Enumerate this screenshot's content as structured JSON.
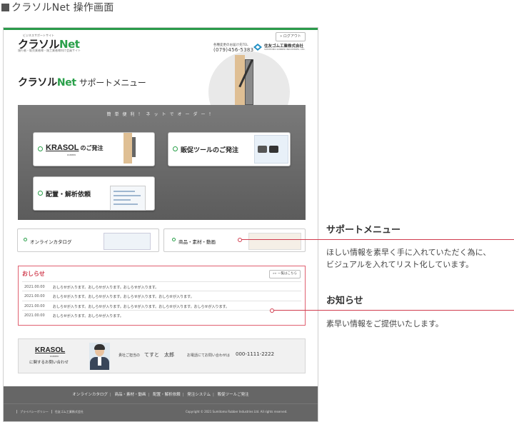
{
  "caption": "クラソルNet 操作画面",
  "header": {
    "logo_small": "ビジネスサポートサイト",
    "logo_main": "クラソル",
    "logo_net": "Net",
    "logo_sub": "施行者・販売業者様・施工業者様向け会員サイト",
    "logout": "» ログアウト",
    "tel_label": "各種変更のお届け先TEL",
    "tel": "(079)456-5383",
    "corp": "住友ゴム工業株式会社",
    "corp_en": "SUMITOMO RUBBER INDUSTRIES, LTD."
  },
  "page_title": {
    "brand": "クラソル",
    "net": "Net",
    "sub": "サポートメニュー"
  },
  "banner": {
    "title": "簡単便利！ネットでオーダー！",
    "krasol_logo": "KRASOL",
    "krasol_sub": "RUBBER",
    "krasol_suffix": "のご発注",
    "promo": "販促ツールのご発注",
    "layout": "配置・解析依頼"
  },
  "links": {
    "catalog": "オンラインカタログ",
    "products": "商品・素材・動画"
  },
  "news": {
    "title": "おしらせ",
    "list_button": "»» 一覧はこちら",
    "items": [
      {
        "date": "2021.00.00",
        "text": "おしらせが入ります。おしらせが入ります。おしらせが入ります。"
      },
      {
        "date": "2021.00.00",
        "text": "おしらせが入ります。おしらせが入ります。おしらせが入ります。おしらせが入ります。"
      },
      {
        "date": "2021.00.00",
        "text": "おしらせが入ります。おしらせが入ります。おしらせが入ります。おしらせが入ります。おしらせが入ります。"
      },
      {
        "date": "2021.00.00",
        "text": "おしらせが入ります。おしらせが入ります。"
      }
    ]
  },
  "contact": {
    "logo": "KRASOL",
    "logo_sub": "RUBBER",
    "label": "に関するお問い合わせ",
    "staff_label": "貴社ご担当の",
    "staff_name": "てすと　太郎",
    "phone_label": "お電話にてお問い合わせは",
    "phone": "000-1111-2222"
  },
  "footer": {
    "links": [
      "オンラインカタログ",
      "商品・素材・動画",
      "配置・解析依頼",
      "発注システム",
      "販促ツールご発注"
    ],
    "policy": [
      "プライバシーポリシー",
      "住友ゴム工業株式会社"
    ],
    "copyright": "Copyright © 2021 Sumitomo Rubber Industries Ltd. All rights reserved."
  },
  "annotations": {
    "support_title": "サポートメニュー",
    "support_desc1": "ほしい情報を素早く手に入れていただく為に、",
    "support_desc2": "ビジュアルを入れてリスト化しています。",
    "news_title": "お知らせ",
    "news_desc": "素早い情報をご提供いたします。"
  },
  "colors": {
    "accent_green": "#2aa04a",
    "news_red": "#d03c4e",
    "footer_gray": "#666666"
  }
}
